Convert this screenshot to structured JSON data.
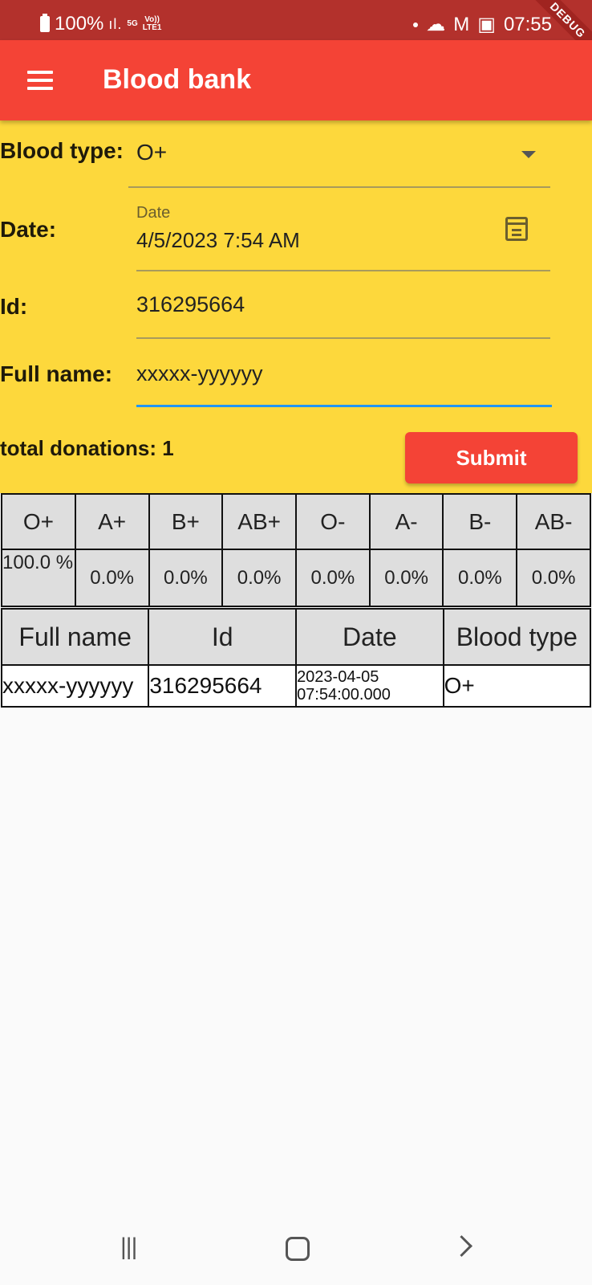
{
  "status_bar": {
    "battery": "100%",
    "network_top": "5G",
    "network_bottom": "LTE1",
    "volte": "Vo))",
    "time": "07:55",
    "debug": "DEBUG"
  },
  "app_bar": {
    "title": "Blood bank",
    "menu_icon": "hamburger-menu-icon"
  },
  "form": {
    "blood_type_label": "Blood type:",
    "blood_type_value": "O+",
    "date_label": "Date:",
    "date_small_label": "Date",
    "date_value": "4/5/2023 7:54 AM",
    "id_label": "Id:",
    "id_value": "316295664",
    "full_name_label": "Full name:",
    "full_name_value": "xxxxx-yyyyyy",
    "total_donations": "total donations: 1",
    "submit_label": "Submit"
  },
  "distribution_table": {
    "headers": [
      "O+",
      "A+",
      "B+",
      "AB+",
      "O-",
      "A-",
      "B-",
      "AB-"
    ],
    "values": [
      "100.0 %",
      "0.0%",
      "0.0%",
      "0.0%",
      "0.0%",
      "0.0%",
      "0.0%",
      "0.0%"
    ]
  },
  "donations_table": {
    "headers": [
      "Full name",
      "Id",
      "Date",
      "Blood type"
    ],
    "rows": [
      [
        "xxxxx-yyyyyy",
        "316295664",
        "2023-04-05 07:54:00.000",
        "O+"
      ]
    ]
  },
  "colors": {
    "status_bar": "#b3312c",
    "app_bar": "#f44336",
    "form_bg": "#fdd83c",
    "submit": "#f44336",
    "focused_underline": "#2196f3"
  }
}
